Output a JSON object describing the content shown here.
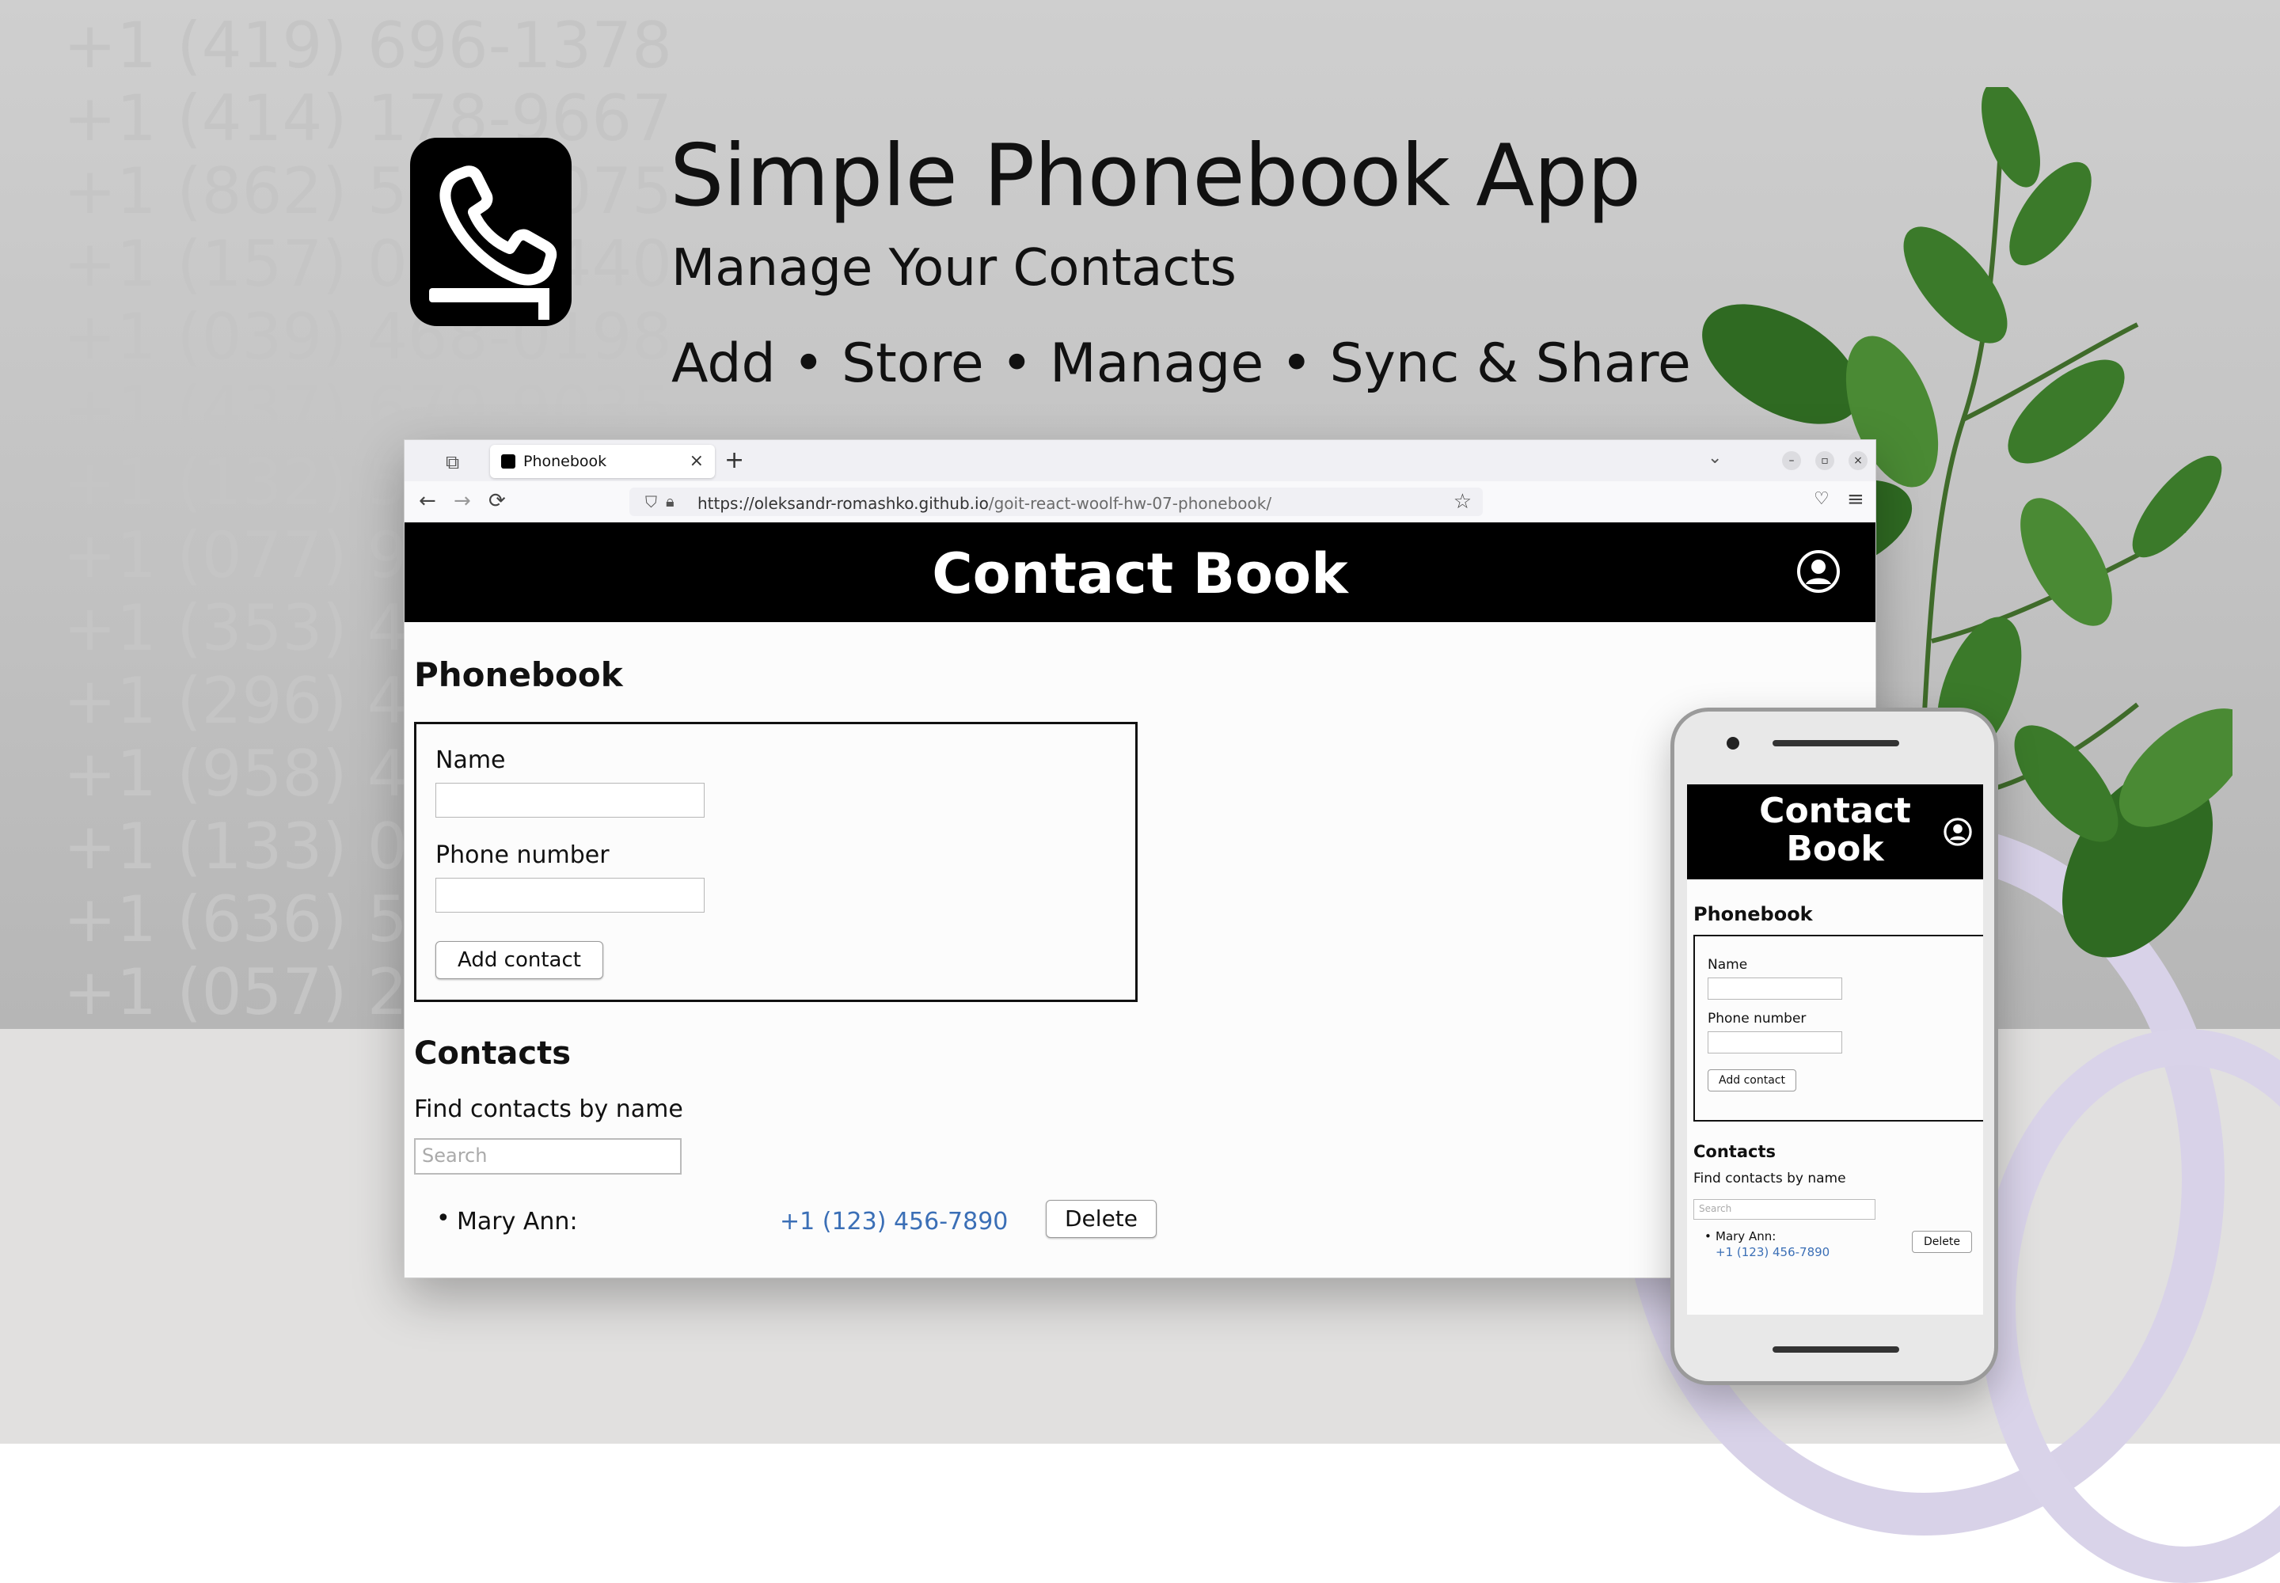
{
  "hero": {
    "title": "Simple Phonebook App",
    "subtitle": "Manage Your Contacts",
    "features": "Add • Store • Manage • Sync & Share"
  },
  "background_numbers": [
    "+1 (419) 696-1378",
    "+1 (414) 178-9667",
    "+1 (862) 503-3075",
    "+1 (157) 012-6440",
    "+1 (039) 468-0198",
    "+1 (437) 679-9035",
    "+1 (132) 506-2911",
    "+1 (077) 998-4460",
    "+1 (353) 452-1207",
    "+1 (296) 457-3384",
    "+1 (958) 493-6215",
    "+1 (133) 062-7759",
    "+1 (636) 538-4902",
    "+1 (057) 200-8163"
  ],
  "browser": {
    "tab_title": "Phonebook",
    "tab_close": "×",
    "new_tab": "+",
    "url_host": "https://oleksandr-romashko.github.io",
    "url_path": "/goit-react-woolf-hw-07-phonebook/",
    "back": "←",
    "forward": "→",
    "reload": "⟳",
    "star": "☆",
    "menu": "≡",
    "minimize": "–",
    "maximize": "▫",
    "close": "×",
    "tab_list": "⌄"
  },
  "app": {
    "header_title": "Contact Book",
    "page_title": "Phonebook",
    "name_label": "Name",
    "phone_label": "Phone number",
    "add_button": "Add contact",
    "contacts_title": "Contacts",
    "filter_label": "Find contacts by name",
    "search_placeholder": "Search",
    "contacts": [
      {
        "name": "Mary Ann:",
        "phone": "+1 (123) 456-7890",
        "delete_label": "Delete"
      }
    ]
  },
  "mobile": {
    "header_title_line1": "Contact",
    "header_title_line2": "Book"
  },
  "colors": {
    "header_bg": "#000000",
    "phone_link": "#3b6fb6",
    "ring": "#d8d2e8"
  }
}
